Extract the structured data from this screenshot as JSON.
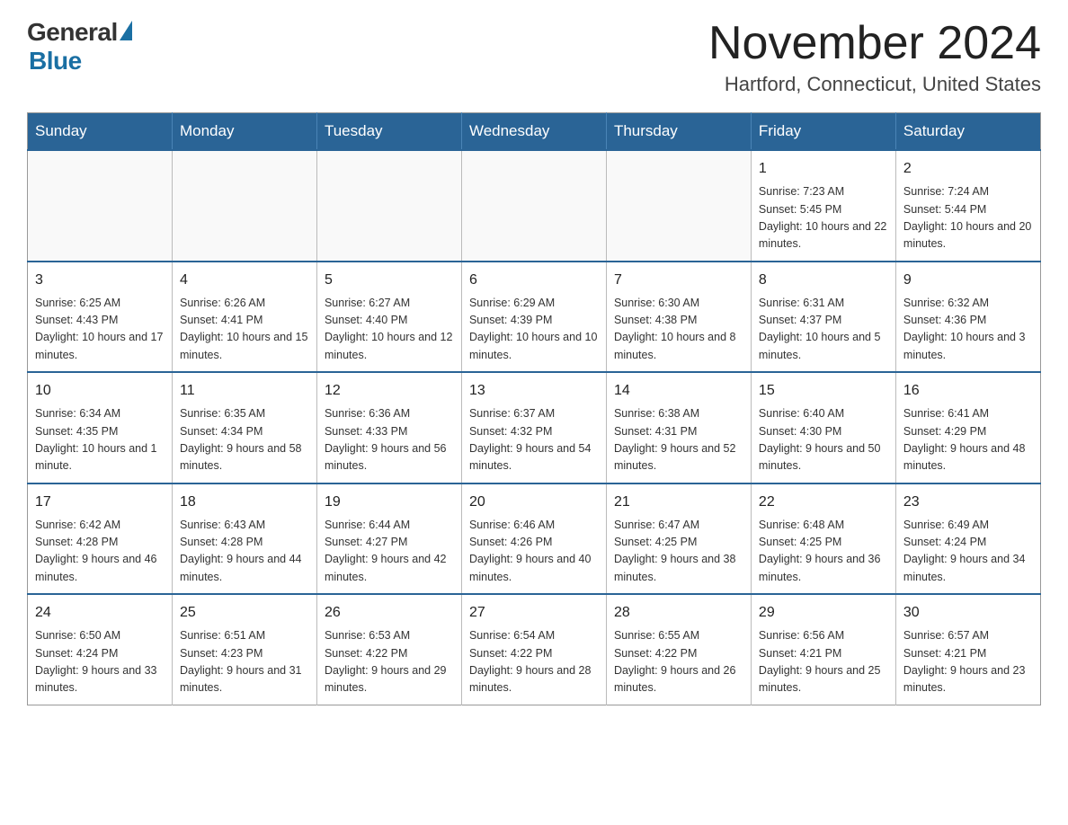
{
  "logo": {
    "general_text": "General",
    "blue_text": "Blue"
  },
  "title": {
    "month_year": "November 2024",
    "location": "Hartford, Connecticut, United States"
  },
  "weekdays": [
    "Sunday",
    "Monday",
    "Tuesday",
    "Wednesday",
    "Thursday",
    "Friday",
    "Saturday"
  ],
  "weeks": [
    [
      {
        "day": "",
        "info": ""
      },
      {
        "day": "",
        "info": ""
      },
      {
        "day": "",
        "info": ""
      },
      {
        "day": "",
        "info": ""
      },
      {
        "day": "",
        "info": ""
      },
      {
        "day": "1",
        "info": "Sunrise: 7:23 AM\nSunset: 5:45 PM\nDaylight: 10 hours and 22 minutes."
      },
      {
        "day": "2",
        "info": "Sunrise: 7:24 AM\nSunset: 5:44 PM\nDaylight: 10 hours and 20 minutes."
      }
    ],
    [
      {
        "day": "3",
        "info": "Sunrise: 6:25 AM\nSunset: 4:43 PM\nDaylight: 10 hours and 17 minutes."
      },
      {
        "day": "4",
        "info": "Sunrise: 6:26 AM\nSunset: 4:41 PM\nDaylight: 10 hours and 15 minutes."
      },
      {
        "day": "5",
        "info": "Sunrise: 6:27 AM\nSunset: 4:40 PM\nDaylight: 10 hours and 12 minutes."
      },
      {
        "day": "6",
        "info": "Sunrise: 6:29 AM\nSunset: 4:39 PM\nDaylight: 10 hours and 10 minutes."
      },
      {
        "day": "7",
        "info": "Sunrise: 6:30 AM\nSunset: 4:38 PM\nDaylight: 10 hours and 8 minutes."
      },
      {
        "day": "8",
        "info": "Sunrise: 6:31 AM\nSunset: 4:37 PM\nDaylight: 10 hours and 5 minutes."
      },
      {
        "day": "9",
        "info": "Sunrise: 6:32 AM\nSunset: 4:36 PM\nDaylight: 10 hours and 3 minutes."
      }
    ],
    [
      {
        "day": "10",
        "info": "Sunrise: 6:34 AM\nSunset: 4:35 PM\nDaylight: 10 hours and 1 minute."
      },
      {
        "day": "11",
        "info": "Sunrise: 6:35 AM\nSunset: 4:34 PM\nDaylight: 9 hours and 58 minutes."
      },
      {
        "day": "12",
        "info": "Sunrise: 6:36 AM\nSunset: 4:33 PM\nDaylight: 9 hours and 56 minutes."
      },
      {
        "day": "13",
        "info": "Sunrise: 6:37 AM\nSunset: 4:32 PM\nDaylight: 9 hours and 54 minutes."
      },
      {
        "day": "14",
        "info": "Sunrise: 6:38 AM\nSunset: 4:31 PM\nDaylight: 9 hours and 52 minutes."
      },
      {
        "day": "15",
        "info": "Sunrise: 6:40 AM\nSunset: 4:30 PM\nDaylight: 9 hours and 50 minutes."
      },
      {
        "day": "16",
        "info": "Sunrise: 6:41 AM\nSunset: 4:29 PM\nDaylight: 9 hours and 48 minutes."
      }
    ],
    [
      {
        "day": "17",
        "info": "Sunrise: 6:42 AM\nSunset: 4:28 PM\nDaylight: 9 hours and 46 minutes."
      },
      {
        "day": "18",
        "info": "Sunrise: 6:43 AM\nSunset: 4:28 PM\nDaylight: 9 hours and 44 minutes."
      },
      {
        "day": "19",
        "info": "Sunrise: 6:44 AM\nSunset: 4:27 PM\nDaylight: 9 hours and 42 minutes."
      },
      {
        "day": "20",
        "info": "Sunrise: 6:46 AM\nSunset: 4:26 PM\nDaylight: 9 hours and 40 minutes."
      },
      {
        "day": "21",
        "info": "Sunrise: 6:47 AM\nSunset: 4:25 PM\nDaylight: 9 hours and 38 minutes."
      },
      {
        "day": "22",
        "info": "Sunrise: 6:48 AM\nSunset: 4:25 PM\nDaylight: 9 hours and 36 minutes."
      },
      {
        "day": "23",
        "info": "Sunrise: 6:49 AM\nSunset: 4:24 PM\nDaylight: 9 hours and 34 minutes."
      }
    ],
    [
      {
        "day": "24",
        "info": "Sunrise: 6:50 AM\nSunset: 4:24 PM\nDaylight: 9 hours and 33 minutes."
      },
      {
        "day": "25",
        "info": "Sunrise: 6:51 AM\nSunset: 4:23 PM\nDaylight: 9 hours and 31 minutes."
      },
      {
        "day": "26",
        "info": "Sunrise: 6:53 AM\nSunset: 4:22 PM\nDaylight: 9 hours and 29 minutes."
      },
      {
        "day": "27",
        "info": "Sunrise: 6:54 AM\nSunset: 4:22 PM\nDaylight: 9 hours and 28 minutes."
      },
      {
        "day": "28",
        "info": "Sunrise: 6:55 AM\nSunset: 4:22 PM\nDaylight: 9 hours and 26 minutes."
      },
      {
        "day": "29",
        "info": "Sunrise: 6:56 AM\nSunset: 4:21 PM\nDaylight: 9 hours and 25 minutes."
      },
      {
        "day": "30",
        "info": "Sunrise: 6:57 AM\nSunset: 4:21 PM\nDaylight: 9 hours and 23 minutes."
      }
    ]
  ]
}
